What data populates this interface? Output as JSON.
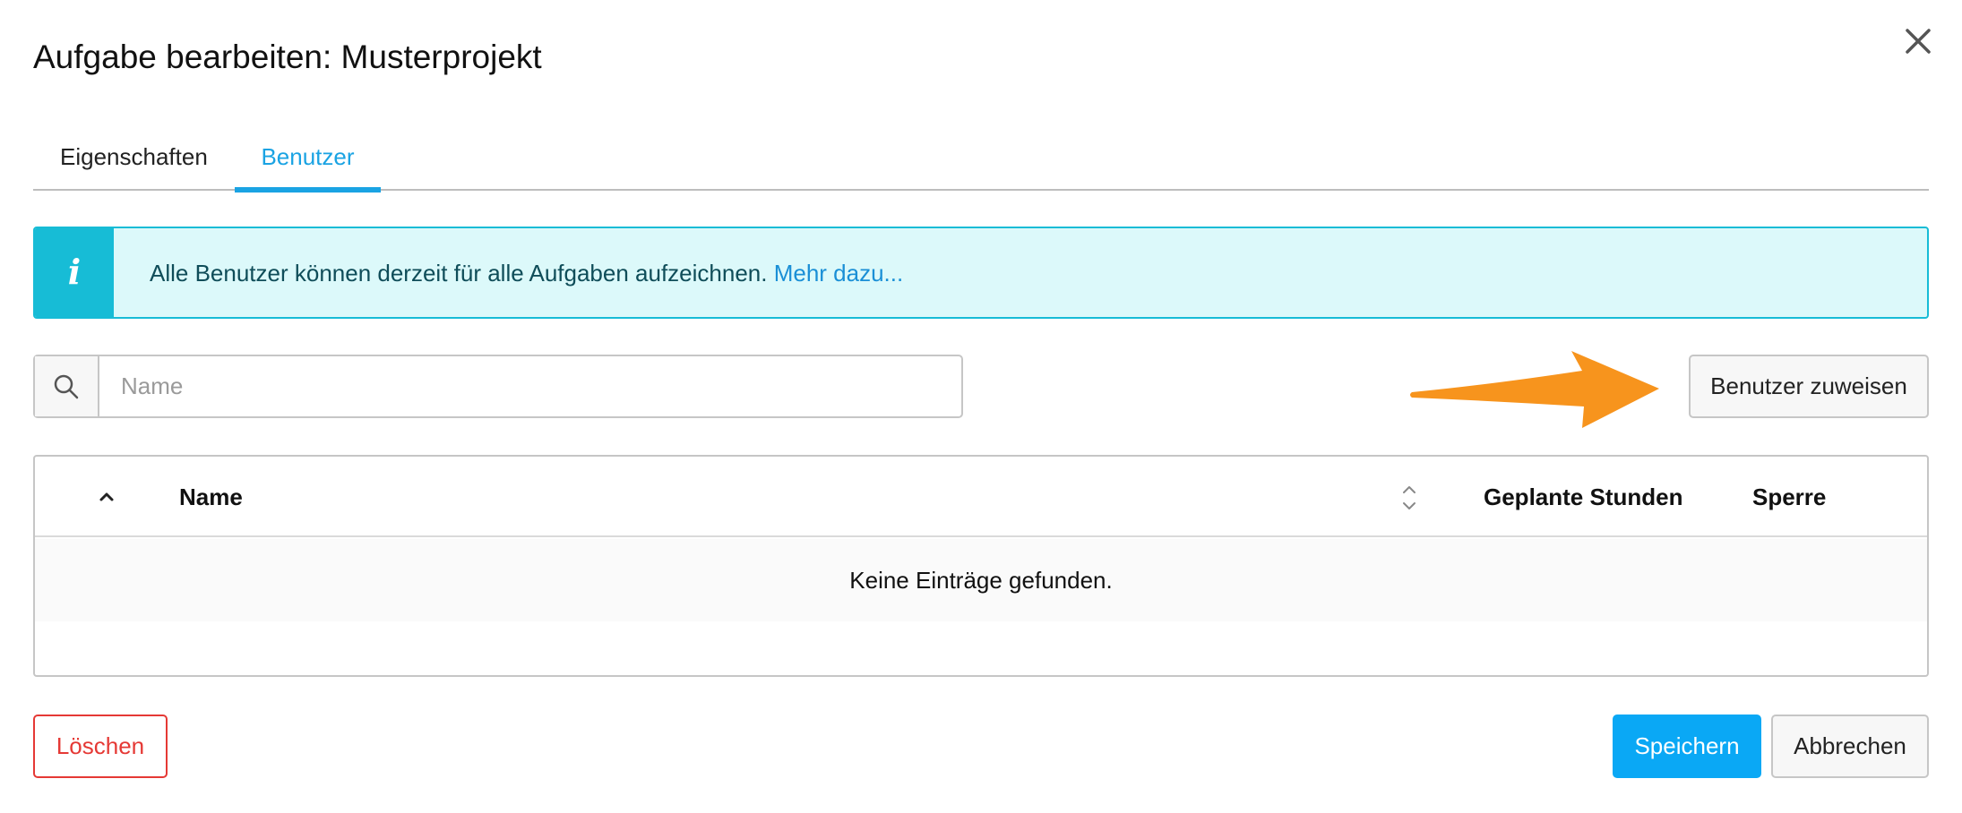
{
  "dialog": {
    "title": "Aufgabe bearbeiten: Musterprojekt",
    "close_icon": "close-icon"
  },
  "tabs": [
    {
      "label": "Eigenschaften",
      "active": false
    },
    {
      "label": "Benutzer",
      "active": true
    }
  ],
  "info": {
    "icon": "info-icon",
    "text": "Alle Benutzer können derzeit für alle Aufgaben aufzeichnen.",
    "link": "Mehr dazu..."
  },
  "search": {
    "icon": "search-icon",
    "placeholder": "Name",
    "value": ""
  },
  "assign_button": {
    "label": "Benutzer zuweisen"
  },
  "table": {
    "columns": [
      "Name",
      "Geplante Stunden",
      "Sperre"
    ],
    "empty_message": "Keine Einträge gefunden.",
    "rows": []
  },
  "footer": {
    "delete_label": "Löschen",
    "save_label": "Speichern",
    "cancel_label": "Abbrechen"
  },
  "colors": {
    "accent": "#1aa3e3",
    "info_border": "#17bcd6",
    "info_background": "#dcf9fa",
    "danger": "#e53935",
    "primary": "#0aa8f5",
    "annotation_arrow": "#f7941d"
  }
}
